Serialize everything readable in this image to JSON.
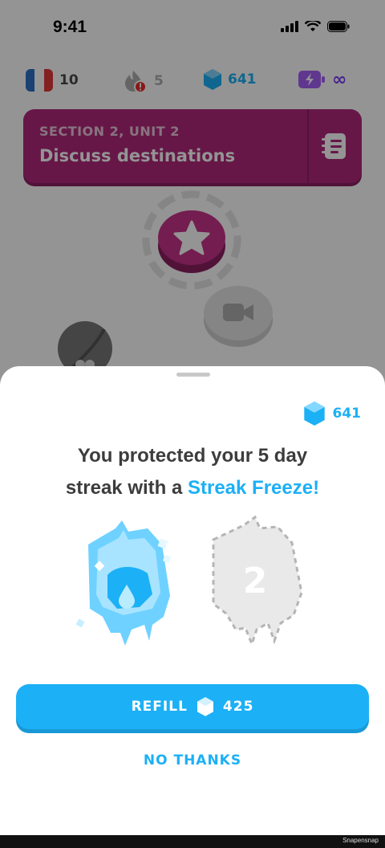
{
  "status_bar": {
    "time": "9:41"
  },
  "stats": {
    "courses": "10",
    "streak": "5",
    "gems": "641",
    "energy": "∞"
  },
  "unit": {
    "section": "SECTION 2, UNIT 2",
    "title": "Discuss destinations"
  },
  "sheet": {
    "gems": "641",
    "headline_part1": "You protected your 5 day",
    "headline_part2": "streak with a ",
    "headline_accent": "Streak Freeze!",
    "slot_number": "2",
    "refill_label": "REFILL",
    "refill_cost": "425",
    "no_thanks_label": "NO THANKS"
  },
  "footer": {
    "watermark": "Snapensnap"
  },
  "colors": {
    "accent": "#1cb0f6",
    "unit_card": "#b0287a",
    "text": "#3c3c3c"
  }
}
